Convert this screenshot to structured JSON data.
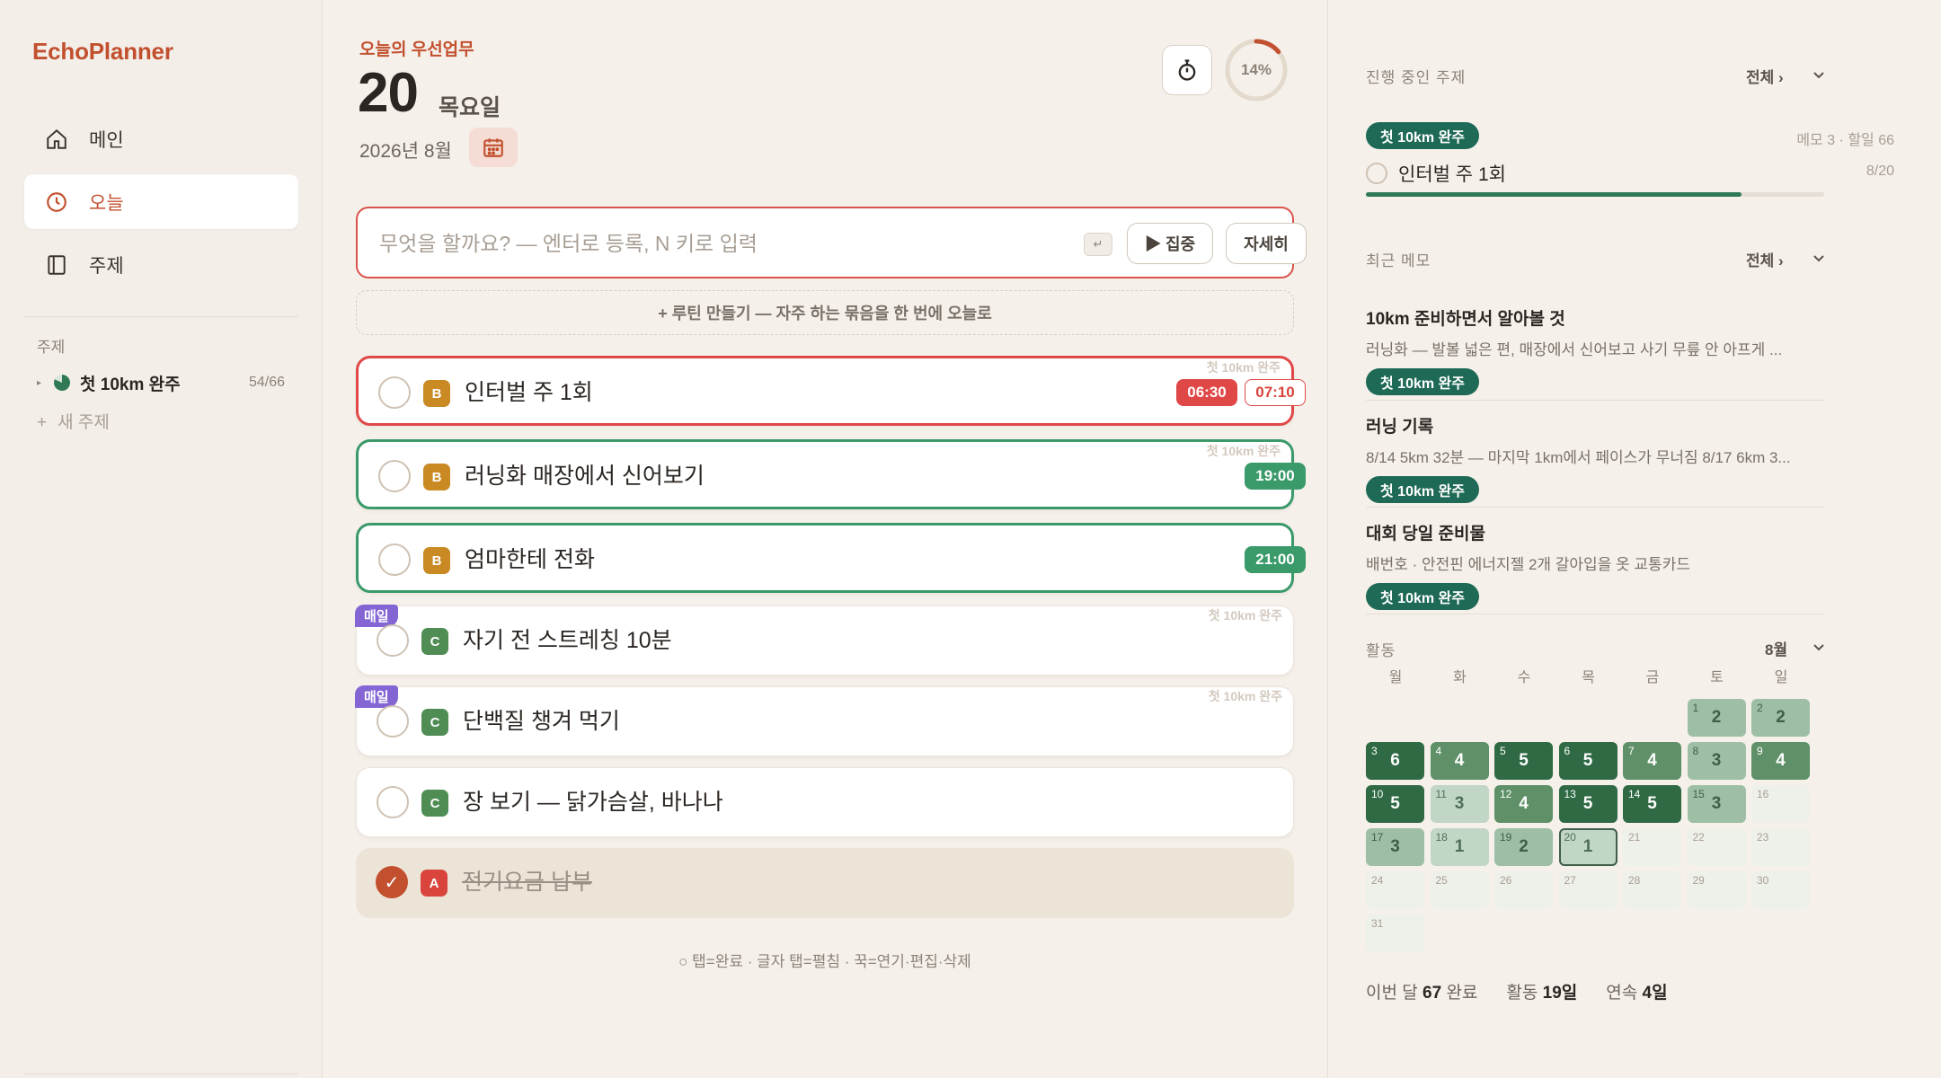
{
  "app": {
    "name": "EchoPlanner"
  },
  "nav": [
    {
      "label": "메인",
      "icon": "home-icon"
    },
    {
      "label": "오늘",
      "icon": "clock-icon",
      "active": true
    },
    {
      "label": "주제",
      "icon": "panel-icon"
    }
  ],
  "sidebar_topics": {
    "section": "주제",
    "items": [
      {
        "name": "첫 10km 완주",
        "count": "54/66",
        "progress": 0.818
      }
    ],
    "new_topic": "새 주제"
  },
  "header": {
    "eyebrow": "오늘의 우선업무",
    "day": "20",
    "weekday": "목요일",
    "month": "2026년 8월",
    "progress_label": "14%",
    "progress": 0.14
  },
  "composer": {
    "placeholder": "무엇을 할까요? — 엔터로 등록, N 키로 입력",
    "enter_key": "↵",
    "focus_label": "▶ 집중",
    "detail_label": "자세히"
  },
  "routine_label": "+ 루틴 만들기 — 자주 하는 묶음을 한 번에 오늘로",
  "tasks": [
    {
      "title": "인터벌 주 1회",
      "priority": "B",
      "topic": "첫 10km 완주",
      "time1": "06:30",
      "time2": "07:10"
    },
    {
      "title": "러닝화 매장에서 신어보기",
      "priority": "B",
      "topic": "첫 10km 완주",
      "time1": "19:00"
    },
    {
      "title": "엄마한테 전화",
      "priority": "B",
      "time1": "21:00"
    },
    {
      "title": "자기 전 스트레칭 10분",
      "priority": "C",
      "topic": "첫 10km 완주",
      "daily": "매일"
    },
    {
      "title": "단백질 챙겨 먹기",
      "priority": "C",
      "topic": "첫 10km 완주",
      "daily": "매일"
    },
    {
      "title": "장 보기 — 닭가슴살, 바나나",
      "priority": "C"
    },
    {
      "title": "전기요금 납부",
      "priority": "A",
      "done": true,
      "check": "✓"
    }
  ],
  "hint": "○ 탭=완료 · 글자 탭=펼침 · 꾹=연기·편집·삭제",
  "right": {
    "active": {
      "heading": "진행 중인 주제",
      "all": "전체 ›",
      "chip": "첫 10km 완주",
      "meta": "메모 3 · 할일 66",
      "task": "인터벌 주 1회",
      "frac": "8/20",
      "progress": 0.82
    },
    "memos": {
      "heading": "최근 메모",
      "all": "전체 ›",
      "items": [
        {
          "title": "10km 준비하면서 알아볼 것",
          "body": "러닝화 — 발볼 넓은 편, 매장에서 신어보고 사기 무릎 안 아프게 ...",
          "chip": "첫 10km 완주"
        },
        {
          "title": "러닝 기록",
          "body": "8/14 5km 32분 — 마지막 1km에서 페이스가 무너짐 8/17 6km 3...",
          "chip": "첫 10km 완주"
        },
        {
          "title": "대회 당일 준비물",
          "body": "배번호 · 안전핀 에너지젤 2개 갈아입을 옷 교통카드",
          "chip": "첫 10km 완주"
        }
      ]
    },
    "activity": {
      "heading": "활동",
      "month": "8월",
      "weekdays": [
        "월",
        "화",
        "수",
        "목",
        "금",
        "토",
        "일"
      ],
      "first_weekday_index": 5,
      "today": 20,
      "days": [
        {
          "d": "1",
          "c": "2",
          "lv": 2
        },
        {
          "d": "2",
          "c": "2",
          "lv": 2
        },
        {
          "d": "3",
          "c": "6",
          "lv": 4
        },
        {
          "d": "4",
          "c": "4",
          "lv": 3
        },
        {
          "d": "5",
          "c": "5",
          "lv": 4
        },
        {
          "d": "6",
          "c": "5",
          "lv": 4
        },
        {
          "d": "7",
          "c": "4",
          "lv": 3
        },
        {
          "d": "8",
          "c": "3",
          "lv": 2
        },
        {
          "d": "9",
          "c": "4",
          "lv": 3
        },
        {
          "d": "10",
          "c": "5",
          "lv": 4
        },
        {
          "d": "11",
          "c": "3",
          "lv": 1
        },
        {
          "d": "12",
          "c": "4",
          "lv": 3
        },
        {
          "d": "13",
          "c": "5",
          "lv": 4
        },
        {
          "d": "14",
          "c": "5",
          "lv": 4
        },
        {
          "d": "15",
          "c": "3",
          "lv": 2
        },
        {
          "d": "16",
          "c": "",
          "lv": 0
        },
        {
          "d": "17",
          "c": "3",
          "lv": 2
        },
        {
          "d": "18",
          "c": "1",
          "lv": 1
        },
        {
          "d": "19",
          "c": "2",
          "lv": 2
        },
        {
          "d": "20",
          "c": "1",
          "lv": 1
        },
        {
          "d": "21",
          "c": "",
          "lv": 0
        },
        {
          "d": "22",
          "c": "",
          "lv": 0
        },
        {
          "d": "23",
          "c": "",
          "lv": 0
        },
        {
          "d": "24",
          "c": "",
          "lv": 0
        },
        {
          "d": "25",
          "c": "",
          "lv": 0
        },
        {
          "d": "26",
          "c": "",
          "lv": 0
        },
        {
          "d": "27",
          "c": "",
          "lv": 0
        },
        {
          "d": "28",
          "c": "",
          "lv": 0
        },
        {
          "d": "29",
          "c": "",
          "lv": 0
        },
        {
          "d": "30",
          "c": "",
          "lv": 0
        },
        {
          "d": "31",
          "c": "",
          "lv": 0
        }
      ]
    },
    "stats": {
      "month_label": "이번 달",
      "month_value": "67",
      "month_suffix": "완료",
      "active_label": "활동",
      "active_value": "19일",
      "streak_label": "연속",
      "streak_value": "4일"
    }
  },
  "colors": {
    "accent": "#c2502f",
    "danger": "#e04848",
    "success": "#3a9a6a",
    "topic": "#1f6a57",
    "daily": "#8366d4"
  }
}
